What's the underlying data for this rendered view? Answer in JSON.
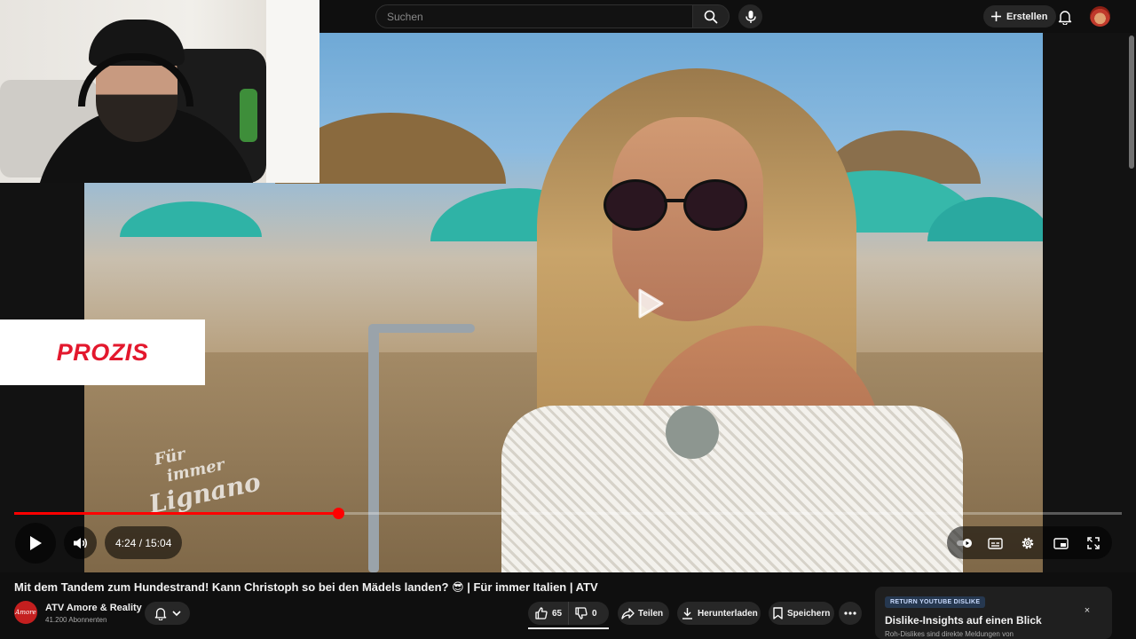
{
  "search": {
    "placeholder": "Suchen"
  },
  "header": {
    "create_label": "Erstellen"
  },
  "sponsor": {
    "text": "PROZIS"
  },
  "watermark": {
    "line1": "Für",
    "line2": "immer",
    "line3": "Lignano"
  },
  "player": {
    "current_time": "4:24",
    "duration": "15:04",
    "time_display": "4:24 / 15:04",
    "progress_fraction": 0.2925
  },
  "video": {
    "title": "Mit dem Tandem zum Hundestrand! Kann Christoph so bei den Mädels landen? 😎 | Für immer Italien | ATV"
  },
  "channel": {
    "name": "ATV Amore & Reality",
    "subscribers": "41.200 Abonnenten",
    "avatar_text": "Amore"
  },
  "actions": {
    "like_count": "65",
    "dislike_count": "0",
    "share_label": "Teilen",
    "download_label": "Herunterladen",
    "save_label": "Speichern"
  },
  "return_dislike": {
    "badge": "RETURN YOUTUBE DISLIKE",
    "title": "Dislike-Insights auf einen Blick",
    "text": "Roh-Dislikes sind direkte Meldungen von",
    "close": "×"
  },
  "colors": {
    "accent": "#ff0000",
    "background": "#0f0f0f",
    "sponsor_red": "#e3182d"
  }
}
